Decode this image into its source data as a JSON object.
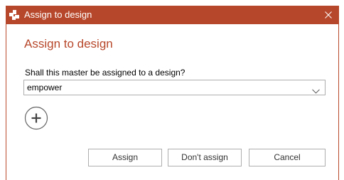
{
  "window": {
    "title": "Assign to design"
  },
  "dialog": {
    "heading": "Assign to design",
    "question": "Shall this master be assigned to a design?",
    "design_select": {
      "selected": "empower"
    },
    "add_icon": "plus-circle-icon"
  },
  "buttons": {
    "assign": "Assign",
    "dont_assign": "Don't assign",
    "cancel": "Cancel"
  },
  "icons": {
    "app": "empower-logo-icon",
    "close": "close-icon",
    "dropdown": "chevron-down-icon"
  },
  "colors": {
    "accent": "#b7472a",
    "titlebar_text": "#ffffff",
    "border": "#aeaeae"
  }
}
